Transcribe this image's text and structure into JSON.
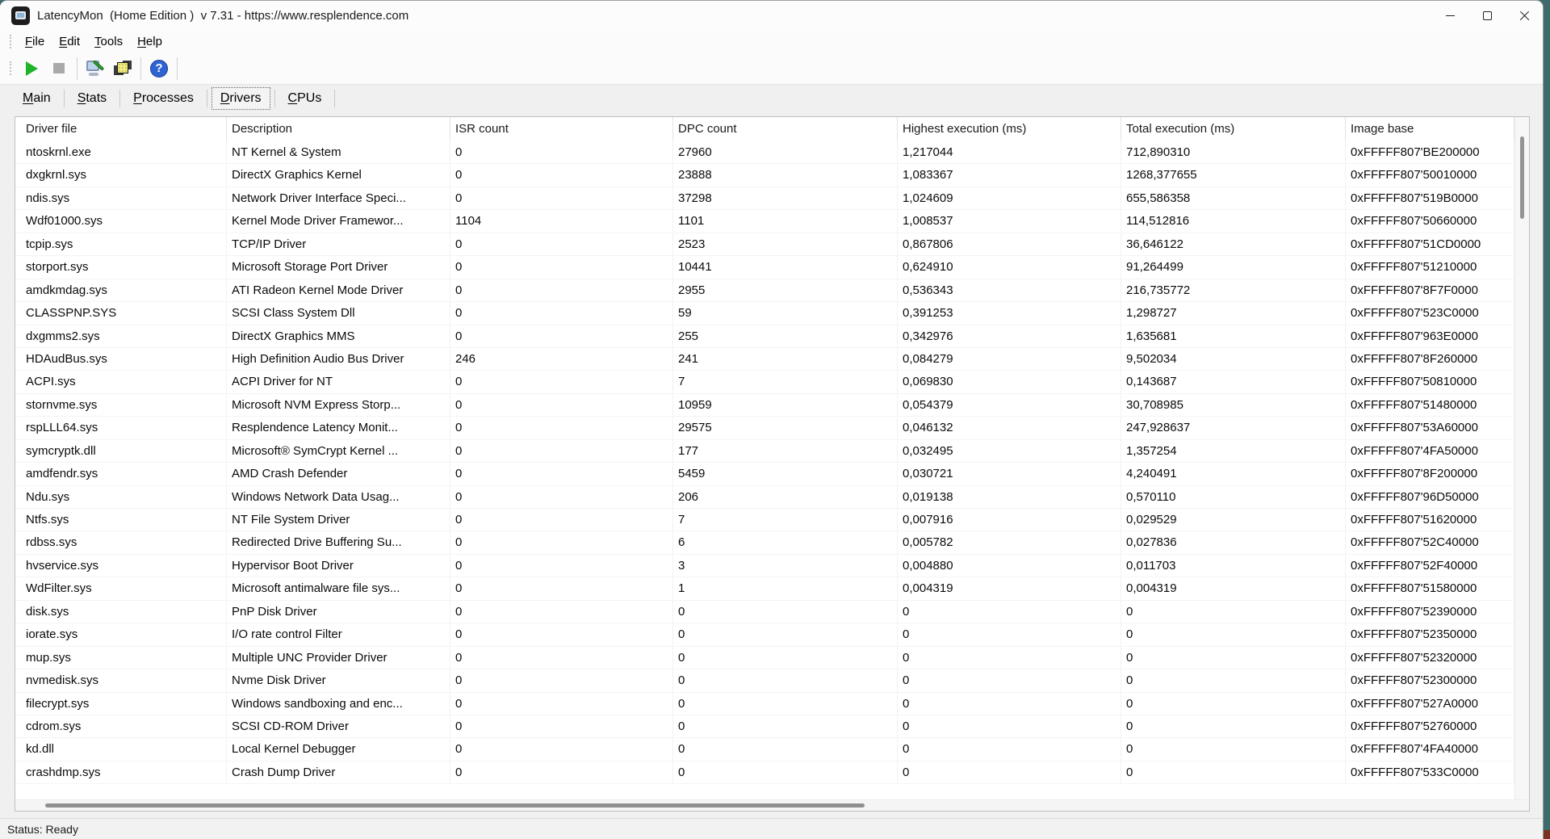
{
  "window": {
    "title": "LatencyMon  (Home Edition )  v 7.31 - https://www.resplendence.com",
    "controls": [
      {
        "name": "minimize-button"
      },
      {
        "name": "maximize-button"
      },
      {
        "name": "close-button"
      }
    ]
  },
  "colors": {
    "desktop": "#3e6a6c",
    "play_green": "#1db32a",
    "help_blue": "#2f63d2",
    "stop_gray": "#a9a9a9",
    "window_bg": "#f0f0f0"
  },
  "menu": {
    "items": [
      {
        "hotkey": "F",
        "rest": "ile"
      },
      {
        "hotkey": "E",
        "rest": "dit"
      },
      {
        "hotkey": "T",
        "rest": "ools"
      },
      {
        "hotkey": "H",
        "rest": "elp"
      }
    ]
  },
  "toolbar": {
    "icons": [
      "start-monitor-icon",
      "stop-monitor-icon",
      "tools-icon",
      "copy-report-icon",
      "help-icon"
    ],
    "help_glyph": "?"
  },
  "tabs": {
    "items": [
      {
        "hotkey": "M",
        "rest": "ain",
        "selected": false
      },
      {
        "hotkey": "S",
        "rest": "tats",
        "selected": false
      },
      {
        "hotkey": "P",
        "rest": "rocesses",
        "selected": false
      },
      {
        "hotkey": "D",
        "rest": "rivers",
        "selected": true
      },
      {
        "hotkey": "C",
        "rest": "PUs",
        "selected": false
      }
    ]
  },
  "table": {
    "columns": [
      "Driver file",
      "Description",
      "ISR count",
      "DPC count",
      "Highest execution (ms)",
      "Total execution (ms)",
      "Image base"
    ],
    "rows": [
      [
        "ntoskrnl.exe",
        "NT Kernel & System",
        "0",
        "27960",
        "1,217044",
        "712,890310",
        "0xFFFFF807'BE200000"
      ],
      [
        "dxgkrnl.sys",
        "DirectX Graphics Kernel",
        "0",
        "23888",
        "1,083367",
        "1268,377655",
        "0xFFFFF807'50010000"
      ],
      [
        "ndis.sys",
        "Network Driver Interface Speci...",
        "0",
        "37298",
        "1,024609",
        "655,586358",
        "0xFFFFF807'519B0000"
      ],
      [
        "Wdf01000.sys",
        "Kernel Mode Driver Framewor...",
        "1104",
        "1101",
        "1,008537",
        "114,512816",
        "0xFFFFF807'50660000"
      ],
      [
        "tcpip.sys",
        "TCP/IP Driver",
        "0",
        "2523",
        "0,867806",
        "36,646122",
        "0xFFFFF807'51CD0000"
      ],
      [
        "storport.sys",
        "Microsoft Storage Port Driver",
        "0",
        "10441",
        "0,624910",
        "91,264499",
        "0xFFFFF807'51210000"
      ],
      [
        "amdkmdag.sys",
        "ATI Radeon Kernel Mode Driver",
        "0",
        "2955",
        "0,536343",
        "216,735772",
        "0xFFFFF807'8F7F0000"
      ],
      [
        "CLASSPNP.SYS",
        "SCSI Class System Dll",
        "0",
        "59",
        "0,391253",
        "1,298727",
        "0xFFFFF807'523C0000"
      ],
      [
        "dxgmms2.sys",
        "DirectX Graphics MMS",
        "0",
        "255",
        "0,342976",
        "1,635681",
        "0xFFFFF807'963E0000"
      ],
      [
        "HDAudBus.sys",
        "High Definition Audio Bus Driver",
        "246",
        "241",
        "0,084279",
        "9,502034",
        "0xFFFFF807'8F260000"
      ],
      [
        "ACPI.sys",
        "ACPI Driver for NT",
        "0",
        "7",
        "0,069830",
        "0,143687",
        "0xFFFFF807'50810000"
      ],
      [
        "stornvme.sys",
        "Microsoft NVM Express Storp...",
        "0",
        "10959",
        "0,054379",
        "30,708985",
        "0xFFFFF807'51480000"
      ],
      [
        "rspLLL64.sys",
        "Resplendence Latency Monit...",
        "0",
        "29575",
        "0,046132",
        "247,928637",
        "0xFFFFF807'53A60000"
      ],
      [
        "symcryptk.dll",
        "Microsoft® SymCrypt Kernel ...",
        "0",
        "177",
        "0,032495",
        "1,357254",
        "0xFFFFF807'4FA50000"
      ],
      [
        "amdfendr.sys",
        "AMD Crash Defender",
        "0",
        "5459",
        "0,030721",
        "4,240491",
        "0xFFFFF807'8F200000"
      ],
      [
        "Ndu.sys",
        "Windows Network Data Usag...",
        "0",
        "206",
        "0,019138",
        "0,570110",
        "0xFFFFF807'96D50000"
      ],
      [
        "Ntfs.sys",
        "NT File System Driver",
        "0",
        "7",
        "0,007916",
        "0,029529",
        "0xFFFFF807'51620000"
      ],
      [
        "rdbss.sys",
        "Redirected Drive Buffering Su...",
        "0",
        "6",
        "0,005782",
        "0,027836",
        "0xFFFFF807'52C40000"
      ],
      [
        "hvservice.sys",
        "Hypervisor Boot Driver",
        "0",
        "3",
        "0,004880",
        "0,011703",
        "0xFFFFF807'52F40000"
      ],
      [
        "WdFilter.sys",
        "Microsoft antimalware file sys...",
        "0",
        "1",
        "0,004319",
        "0,004319",
        "0xFFFFF807'51580000"
      ],
      [
        "disk.sys",
        "PnP Disk Driver",
        "0",
        "0",
        "0",
        "0",
        "0xFFFFF807'52390000"
      ],
      [
        "iorate.sys",
        "I/O rate control Filter",
        "0",
        "0",
        "0",
        "0",
        "0xFFFFF807'52350000"
      ],
      [
        "mup.sys",
        "Multiple UNC Provider Driver",
        "0",
        "0",
        "0",
        "0",
        "0xFFFFF807'52320000"
      ],
      [
        "nvmedisk.sys",
        "Nvme Disk Driver",
        "0",
        "0",
        "0",
        "0",
        "0xFFFFF807'52300000"
      ],
      [
        "filecrypt.sys",
        "Windows sandboxing and enc...",
        "0",
        "0",
        "0",
        "0",
        "0xFFFFF807'527A0000"
      ],
      [
        "cdrom.sys",
        "SCSI CD-ROM Driver",
        "0",
        "0",
        "0",
        "0",
        "0xFFFFF807'52760000"
      ],
      [
        "kd.dll",
        "Local Kernel Debugger",
        "0",
        "0",
        "0",
        "0",
        "0xFFFFF807'4FA40000"
      ],
      [
        "crashdmp.sys",
        "Crash Dump Driver",
        "0",
        "0",
        "0",
        "0",
        "0xFFFFF807'533C0000"
      ]
    ]
  },
  "status": {
    "text": "Status: Ready"
  }
}
